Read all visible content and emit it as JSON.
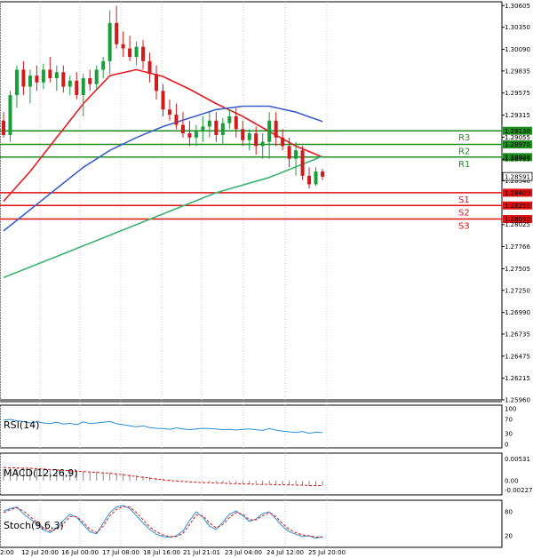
{
  "chart_data": {
    "type": "candlestick",
    "price_axis": {
      "ylim": [
        1.2596,
        1.3065
      ],
      "ticks": [
        "1.30605",
        "1.30350",
        "1.30090",
        "1.29835",
        "1.29575",
        "1.29315",
        "1.29055",
        "1.28795",
        "1.28540",
        "1.28025",
        "1.27766",
        "1.27505",
        "1.27250",
        "1.26990",
        "1.26735",
        "1.26475",
        "1.26215",
        "1.25960"
      ],
      "last_price": "1.28591"
    },
    "time_axis": {
      "labels": [
        "2:00",
        "12 Jul 20:00",
        "16 Jul 00:00",
        "17 Jul 08:00",
        "18 Jul 16:00",
        "21 Jul 21:01",
        "23 Jul 04:00",
        "24 Jul 12:00",
        "25 Jul 20:00"
      ]
    },
    "candles": [
      [
        1.2925,
        1.2935,
        1.2905,
        1.2908
      ],
      [
        1.2908,
        1.296,
        1.29,
        1.2955
      ],
      [
        1.2955,
        1.299,
        1.294,
        1.2985
      ],
      [
        1.2985,
        1.2995,
        1.2955,
        1.2965
      ],
      [
        1.2965,
        1.2985,
        1.2945,
        1.2978
      ],
      [
        1.2978,
        1.299,
        1.296,
        1.297
      ],
      [
        1.297,
        1.2992,
        1.2962,
        1.2985
      ],
      [
        1.2985,
        1.3,
        1.297,
        1.2975
      ],
      [
        1.2975,
        1.299,
        1.296,
        1.2982
      ],
      [
        1.2982,
        1.299,
        1.2958,
        1.2965
      ],
      [
        1.2965,
        1.2978,
        1.2955,
        1.2972
      ],
      [
        1.2972,
        1.2982,
        1.295,
        1.2955
      ],
      [
        1.2955,
        1.298,
        1.293,
        1.2975
      ],
      [
        1.2975,
        1.2985,
        1.296,
        1.2968
      ],
      [
        1.2968,
        1.299,
        1.2962,
        1.2985
      ],
      [
        1.2985,
        1.3,
        1.2975,
        1.2995
      ],
      [
        1.2995,
        1.3055,
        1.298,
        1.304
      ],
      [
        1.304,
        1.306,
        1.301,
        1.3015
      ],
      [
        1.3015,
        1.303,
        1.3,
        1.301
      ],
      [
        1.301,
        1.3025,
        1.2995,
        1.3
      ],
      [
        1.3,
        1.3018,
        1.299,
        1.3012
      ],
      [
        1.3012,
        1.302,
        1.2985,
        1.2995
      ],
      [
        1.2995,
        1.3005,
        1.297,
        1.298
      ],
      [
        1.298,
        1.299,
        1.295,
        1.296
      ],
      [
        1.296,
        1.2968,
        1.293,
        1.2938
      ],
      [
        1.2938,
        1.295,
        1.2925,
        1.2932
      ],
      [
        1.2932,
        1.2945,
        1.2915,
        1.292
      ],
      [
        1.292,
        1.2935,
        1.2905,
        1.291
      ],
      [
        1.291,
        1.2925,
        1.2895,
        1.2905
      ],
      [
        1.2905,
        1.292,
        1.2895,
        1.2912
      ],
      [
        1.2912,
        1.293,
        1.29,
        1.2918
      ],
      [
        1.2918,
        1.2935,
        1.2905,
        1.2925
      ],
      [
        1.2925,
        1.2935,
        1.29,
        1.2908
      ],
      [
        1.2908,
        1.2928,
        1.2898,
        1.2922
      ],
      [
        1.2922,
        1.2938,
        1.2915,
        1.293
      ],
      [
        1.293,
        1.294,
        1.2905,
        1.2915
      ],
      [
        1.2915,
        1.2925,
        1.2895,
        1.2902
      ],
      [
        1.2902,
        1.2915,
        1.289,
        1.291
      ],
      [
        1.291,
        1.2918,
        1.2885,
        1.2895
      ],
      [
        1.2895,
        1.291,
        1.288,
        1.29
      ],
      [
        1.29,
        1.2935,
        1.288,
        1.2925
      ],
      [
        1.2925,
        1.2935,
        1.2895,
        1.2905
      ],
      [
        1.2905,
        1.2915,
        1.289,
        1.2895
      ],
      [
        1.2895,
        1.2905,
        1.287,
        1.288
      ],
      [
        1.288,
        1.29,
        1.286,
        1.289
      ],
      [
        1.289,
        1.2895,
        1.2855,
        1.286
      ],
      [
        1.286,
        1.287,
        1.2845,
        1.285
      ],
      [
        1.285,
        1.287,
        1.2848,
        1.2865
      ],
      [
        1.2865,
        1.2868,
        1.2855,
        1.2859
      ]
    ],
    "moving_averages": [
      {
        "color": "#e8191f",
        "points": [
          [
            0,
            1.283
          ],
          [
            4,
            1.2865
          ],
          [
            8,
            1.2905
          ],
          [
            12,
            1.2945
          ],
          [
            16,
            1.2978
          ],
          [
            20,
            1.2985
          ],
          [
            24,
            1.2977
          ],
          [
            28,
            1.2962
          ],
          [
            32,
            1.2945
          ],
          [
            36,
            1.293
          ],
          [
            40,
            1.2912
          ],
          [
            44,
            1.2895
          ],
          [
            48,
            1.2882
          ]
        ]
      },
      {
        "color": "#3a5fcd",
        "points": [
          [
            0,
            1.2795
          ],
          [
            4,
            1.282
          ],
          [
            8,
            1.2845
          ],
          [
            12,
            1.287
          ],
          [
            16,
            1.289
          ],
          [
            20,
            1.2905
          ],
          [
            24,
            1.2918
          ],
          [
            28,
            1.2928
          ],
          [
            32,
            1.2938
          ],
          [
            36,
            1.2942
          ],
          [
            40,
            1.2942
          ],
          [
            44,
            1.2935
          ],
          [
            48,
            1.2924
          ]
        ]
      },
      {
        "color": "#3cb371",
        "points": [
          [
            0,
            1.274
          ],
          [
            8,
            1.2765
          ],
          [
            16,
            1.279
          ],
          [
            24,
            1.2815
          ],
          [
            32,
            1.284
          ],
          [
            40,
            1.2858
          ],
          [
            48,
            1.2883
          ]
        ]
      }
    ],
    "levels": [
      {
        "name": "R3",
        "value": "1.29130",
        "color": "#1e8c1e"
      },
      {
        "name": "R2",
        "value": "1.28970",
        "color": "#1e8c1e"
      },
      {
        "name": "R1",
        "value": "1.28820",
        "color": "#1e8c1e"
      },
      {
        "name": "S1",
        "value": "1.28400",
        "color": "#e01010"
      },
      {
        "name": "S2",
        "value": "1.28250",
        "color": "#e01010"
      },
      {
        "name": "S3",
        "value": "1.28090",
        "color": "#e01010"
      }
    ],
    "indicators": [
      {
        "label": "RSI(14)",
        "ticks": [
          "100",
          "70",
          "30",
          "0"
        ],
        "ylim": [
          0,
          100
        ],
        "values": [
          68,
          70,
          66,
          64,
          60,
          63,
          60,
          58,
          62,
          57,
          59,
          55,
          63,
          58,
          60,
          62,
          64,
          58,
          55,
          52,
          49,
          52,
          47,
          45,
          44,
          42,
          46,
          43,
          41,
          43,
          45,
          44,
          43,
          41,
          42,
          40,
          42,
          43,
          41,
          39,
          44,
          40,
          37,
          35,
          33,
          36,
          31,
          34,
          33
        ]
      },
      {
        "label": "MACD(12,26,9)",
        "ticks": [
          "0.00531",
          "0.00",
          "-0.002275"
        ],
        "ylim": [
          -0.0026,
          0.0058
        ],
        "values": [
          0.0028,
          0.0029,
          0.003,
          0.0031,
          0.0031,
          0.003,
          0.0029,
          0.0028,
          0.0027,
          0.0026,
          0.0025,
          0.0024,
          0.0023,
          0.0022,
          0.0021,
          0.002,
          0.0019,
          0.0018,
          0.0017,
          0.0015,
          0.0013,
          0.0011,
          0.0009,
          0.0007,
          0.0005,
          0.0003,
          0.0002,
          0.0001,
          0.0,
          -0.0001,
          -0.0002,
          -0.0003,
          -0.0004,
          -0.0005,
          -0.0005,
          -0.0006,
          -0.0006,
          -0.0007,
          -0.0007,
          -0.0008,
          -0.0008,
          -0.0009,
          -0.0009,
          -0.001,
          -0.001,
          -0.0011,
          -0.0011,
          -0.0012,
          -0.0012
        ],
        "signal": [
          0.0032,
          0.0031,
          0.0031,
          0.003,
          0.003,
          0.0029,
          0.0028,
          0.0027,
          0.0026,
          0.0025,
          0.0024,
          0.0023,
          0.0022,
          0.0021,
          0.002,
          0.0019,
          0.0018,
          0.0016,
          0.0014,
          0.0012,
          0.001,
          0.0008,
          0.0006,
          0.0004,
          0.0002,
          0.0,
          -0.0001,
          -0.0002,
          -0.0003,
          -0.0004,
          -0.0005,
          -0.0005,
          -0.0006,
          -0.0006,
          -0.0007,
          -0.0007,
          -0.0008,
          -0.0008,
          -0.0009,
          -0.0009,
          -0.0009,
          -0.001,
          -0.001,
          -0.001,
          -0.0011,
          -0.0011,
          -0.0012,
          -0.0012,
          -0.0012
        ]
      },
      {
        "label": "Stoch(9,6,3)",
        "ticks": [
          "80",
          "20"
        ],
        "ylim": [
          0,
          100
        ],
        "values": [
          82,
          88,
          92,
          75,
          62,
          50,
          35,
          28,
          40,
          58,
          74,
          66,
          48,
          30,
          25,
          52,
          78,
          92,
          96,
          88,
          70,
          52,
          36,
          24,
          18,
          16,
          20,
          32,
          58,
          80,
          66,
          44,
          36,
          54,
          74,
          82,
          70,
          56,
          62,
          76,
          80,
          62,
          44,
          30,
          24,
          18,
          20,
          14,
          18
        ],
        "signal": [
          78,
          85,
          90,
          82,
          68,
          54,
          40,
          32,
          36,
          50,
          68,
          68,
          54,
          36,
          28,
          44,
          70,
          86,
          93,
          92,
          78,
          60,
          42,
          30,
          22,
          18,
          18,
          26,
          48,
          72,
          70,
          52,
          40,
          48,
          66,
          78,
          74,
          60,
          60,
          70,
          78,
          68,
          50,
          36,
          28,
          22,
          20,
          17,
          17
        ]
      }
    ]
  }
}
